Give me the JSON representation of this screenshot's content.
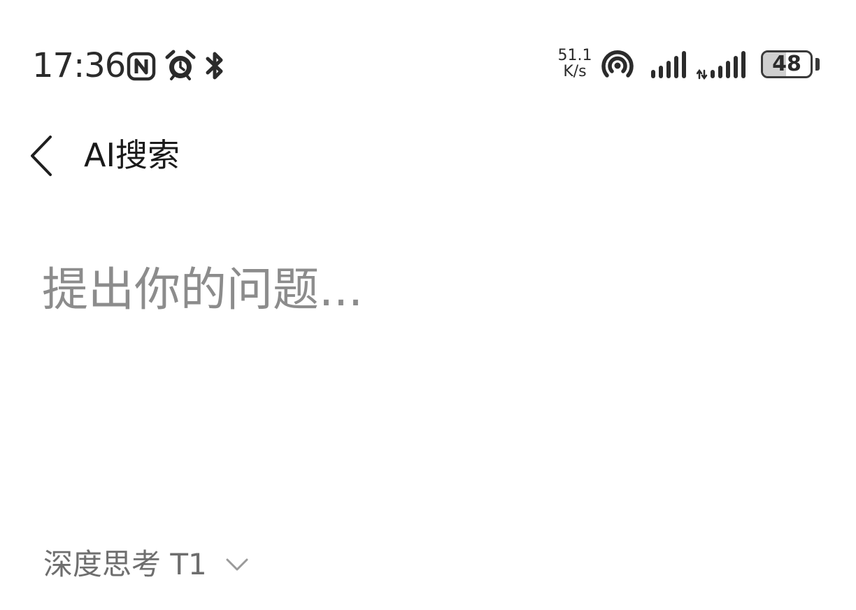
{
  "status_bar": {
    "time": "17:36",
    "icons": [
      "nfc-icon",
      "alarm-icon",
      "bluetooth-icon",
      "hotspot-icon",
      "signal-icon",
      "signal-hd-icon"
    ],
    "net_speed_value": "51.1",
    "net_speed_unit": "K/s",
    "battery_level": "48"
  },
  "header": {
    "back_icon": "chevron-left-icon",
    "title": "AI搜索"
  },
  "question_input": {
    "placeholder": "提出你的问题...",
    "value": ""
  },
  "model_selector": {
    "label": "深度思考 T1",
    "icon": "chevron-down-icon"
  }
}
